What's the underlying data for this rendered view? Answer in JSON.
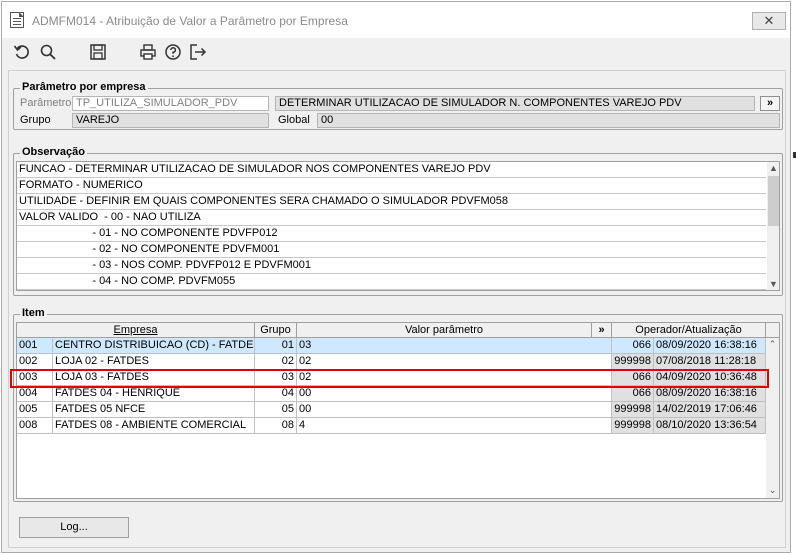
{
  "window": {
    "title": "ADMFM014 - Atribuição de Valor a Parâmetro por Empresa",
    "close_glyph": "✕"
  },
  "toolbar": {
    "buttons": [
      "undo-icon",
      "search-icon",
      "save-icon",
      "print-icon",
      "help-icon",
      "exit-icon"
    ]
  },
  "parametro_group": {
    "legend": "Parâmetro por empresa",
    "parametro_label": "Parâmetro",
    "parametro_value": "TP_UTILIZA_SIMULADOR_PDV",
    "descricao_value": "DETERMINAR UTILIZACAO DE SIMULADOR N. COMPONENTES VAREJO PDV",
    "more_button": "»",
    "grupo_label": "Grupo",
    "grupo_value": "VAREJO",
    "global_label": "Global",
    "global_value": "00"
  },
  "observacao_group": {
    "legend": "Observação",
    "lines": [
      "FUNCAO - DETERMINAR UTILIZACAO DE SIMULADOR NOS COMPONENTES VAREJO PDV",
      "FORMATO - NUMERICO",
      "UTILIDADE - DEFINIR EM QUAIS COMPONENTES SERA CHAMADO O SIMULADOR PDVFM058",
      "VALOR VALIDO  - 00 - NAO UTILIZA",
      "                        - 01 - NO COMPONENTE PDVFP012",
      "                        - 02 - NO COMPONENTE PDVFM001",
      "                        - 03 - NOS COMP. PDVFP012 E PDVFM001",
      "                        - 04 - NO COMP. PDVFM055"
    ]
  },
  "item_group": {
    "legend": "Item",
    "columns": {
      "empresa": "Empresa",
      "grupo": "Grupo",
      "valor": "Valor parâmetro",
      "expand": "»",
      "operador": "Operador/Atualização"
    },
    "rows": [
      {
        "cod": "001",
        "empresa": "CENTRO DISTRIBUICAO (CD) - FATDES",
        "grupo": "01",
        "valor": "03",
        "operador": "066",
        "data": "08/09/2020 16:38:16"
      },
      {
        "cod": "002",
        "empresa": "LOJA 02 - FATDES",
        "grupo": "02",
        "valor": "02",
        "operador": "999998",
        "data": "07/08/2018 11:28:18"
      },
      {
        "cod": "003",
        "empresa": "LOJA 03 - FATDES",
        "grupo": "03",
        "valor": "02",
        "operador": "066",
        "data": "04/09/2020 10:36:48"
      },
      {
        "cod": "004",
        "empresa": "FATDES 04 - HENRIQUE",
        "grupo": "04",
        "valor": "00",
        "operador": "066",
        "data": "08/09/2020 16:38:16"
      },
      {
        "cod": "005",
        "empresa": "FATDES 05 NFCE",
        "grupo": "05",
        "valor": "00",
        "operador": "999998",
        "data": "14/02/2019 17:06:46"
      },
      {
        "cod": "008",
        "empresa": "FATDES 08 - AMBIENTE COMERCIAL",
        "grupo": "08",
        "valor": "4",
        "operador": "999998",
        "data": "08/10/2020 13:36:54"
      }
    ],
    "selected_row": 0,
    "highlighted_row": 2
  },
  "footer": {
    "log_button": "Log..."
  },
  "colors": {
    "selection": "#cde8ff",
    "highlight_border": "#e00000",
    "readonly": "#e0e0e0"
  }
}
